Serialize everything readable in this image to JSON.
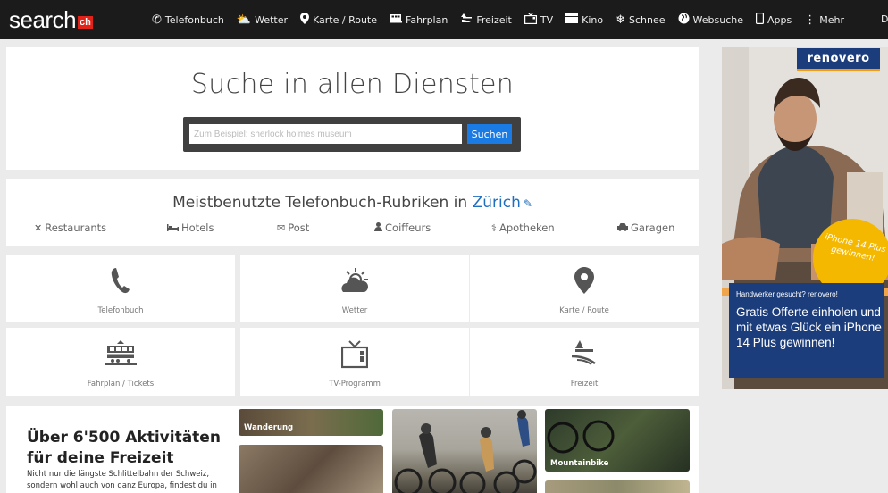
{
  "nav": {
    "logo": "search",
    "logo_badge": "ch",
    "items": [
      {
        "label": "Telefonbuch",
        "icon": "phone-icon"
      },
      {
        "label": "Wetter",
        "icon": "weather-icon"
      },
      {
        "label": "Karte / Route",
        "icon": "map-pin-icon"
      },
      {
        "label": "Fahrplan",
        "icon": "train-icon"
      },
      {
        "label": "Freizeit",
        "icon": "leisure-icon"
      },
      {
        "label": "TV",
        "icon": "tv-icon"
      },
      {
        "label": "Kino",
        "icon": "cinema-icon"
      },
      {
        "label": "Schnee",
        "icon": "snowflake-icon"
      },
      {
        "label": "Websuche",
        "icon": "globe-icon"
      },
      {
        "label": "Apps",
        "icon": "phone-app-icon"
      },
      {
        "label": "Mehr",
        "icon": "more-icon"
      }
    ],
    "edge_letter": "D"
  },
  "search": {
    "title": "Suche in allen Diensten",
    "placeholder": "Zum Beispiel: sherlock holmes museum",
    "button": "Suchen"
  },
  "rubriken": {
    "title_prefix": "Meistbenutzte Telefonbuch-Rubriken in",
    "city": "Zürich",
    "items": [
      {
        "label": "Restaurants",
        "icon": "restaurant-icon"
      },
      {
        "label": "Hotels",
        "icon": "bed-icon"
      },
      {
        "label": "Post",
        "icon": "envelope-icon"
      },
      {
        "label": "Coiffeurs",
        "icon": "person-icon"
      },
      {
        "label": "Apotheken",
        "icon": "pharmacy-icon"
      },
      {
        "label": "Garagen",
        "icon": "car-icon"
      }
    ]
  },
  "tiles": [
    {
      "label": "Telefonbuch",
      "icon": "phone-icon"
    },
    {
      "label": "Wetter",
      "icon": "weather-icon"
    },
    {
      "label": "Karte / Route",
      "icon": "map-pin-icon"
    },
    {
      "label": "Fahrplan / Tickets",
      "icon": "train-icon"
    },
    {
      "label": "TV-Programm",
      "icon": "tv-icon"
    },
    {
      "label": "Freizeit",
      "icon": "leisure-icon"
    }
  ],
  "activities": {
    "title": "Über 6'500 Aktivitäten für deine Freizeit",
    "text": "Nicht nur die längste Schlittelbahn der Schweiz, sondern wohl auch von ganz Europa, findest du in",
    "photos": [
      "Wanderung",
      "Mountainbike"
    ]
  },
  "ad": {
    "brand": "renovero",
    "badge": "iPhone 14 Plus gewinnen!",
    "small": "Handwerker gesucht? renovero!",
    "big": "Gratis Offerte einholen und mit etwas Glück ein iPhone 14 Plus gewinnen!"
  },
  "colors": {
    "nav_bg": "#1b1b1b",
    "accent": "#1a7be5",
    "link": "#1f6fbf",
    "logo_red": "#e2231a",
    "ad_blue": "#1c3d7b",
    "ad_yellow": "#f5b800"
  }
}
